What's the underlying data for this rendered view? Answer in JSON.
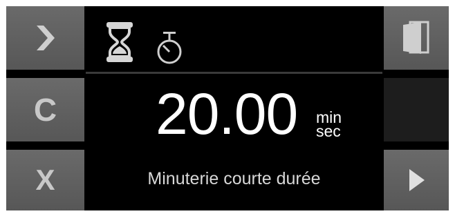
{
  "left_buttons": {
    "next": {
      "icon": "chevron-right-icon",
      "glyph": "❯"
    },
    "clear": {
      "icon": "clear-icon",
      "glyph": "C"
    },
    "close": {
      "icon": "close-icon",
      "glyph": "X"
    }
  },
  "right_buttons": {
    "door": {
      "icon": "door-icon"
    },
    "start": {
      "icon": "play-icon",
      "glyph": "▶"
    }
  },
  "modes": {
    "timer_icon": "hourglass-icon",
    "stopwatch_icon": "stopwatch-icon"
  },
  "display": {
    "value": "20.00",
    "unit_top": "min",
    "unit_bottom": "sec",
    "program_name": "Minuterie courte durée"
  },
  "colors": {
    "background": "#000000",
    "button": "#606060",
    "icon": "#c8c8c8",
    "text": "#ffffff"
  }
}
